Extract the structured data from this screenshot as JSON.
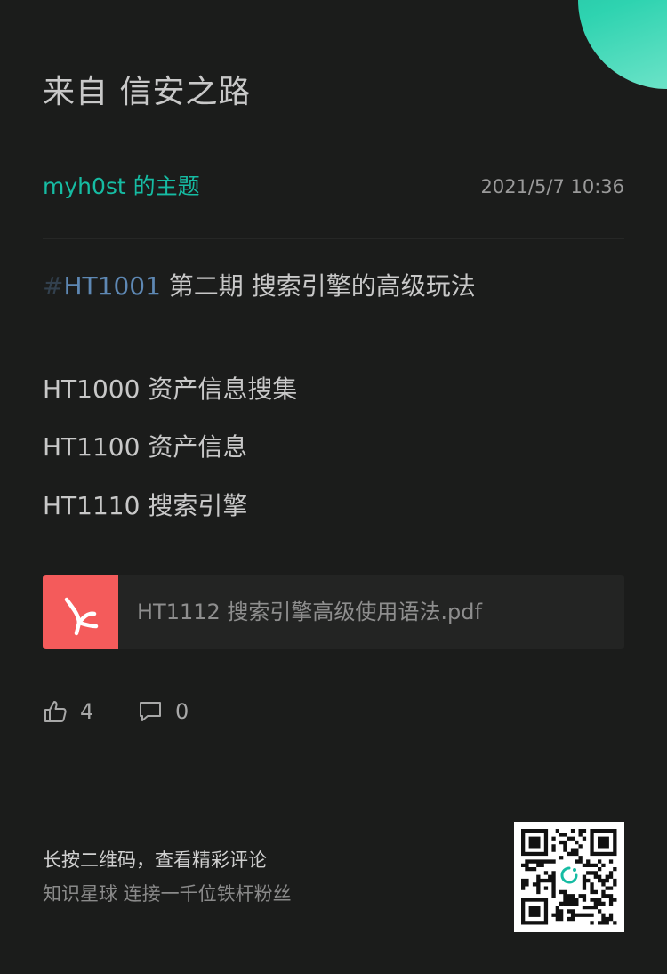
{
  "header": {
    "source_title": "来自 信安之路"
  },
  "meta": {
    "author": "myh0st 的主题",
    "timestamp": "2021/5/7 10:36"
  },
  "post": {
    "hash_symbol": "#",
    "tag": "HT1001",
    "title": "第二期  搜索引擎的高级玩法",
    "lines": [
      "HT1000  资产信息搜集",
      "HT1100  资产信息",
      "HT1110  搜索引擎"
    ]
  },
  "attachment": {
    "icon": "pdf-file-icon",
    "icon_color": "#f45b5b",
    "file_name": "HT1112 搜索引擎高级使用语法.pdf"
  },
  "stats": {
    "like_icon": "thumbs-up-icon",
    "likes": "4",
    "comment_icon": "comment-bubble-icon",
    "comments": "0"
  },
  "footer": {
    "primary_text": "长按二维码，查看精彩评论",
    "secondary_text": "知识星球 连接一千位铁杆粉丝",
    "qr_icon": "qr-code"
  },
  "colors": {
    "background": "#1b1c1b",
    "accent": "#16bca3",
    "tag": "#5e88b4",
    "corner_gradient": "#2ed3b0"
  }
}
